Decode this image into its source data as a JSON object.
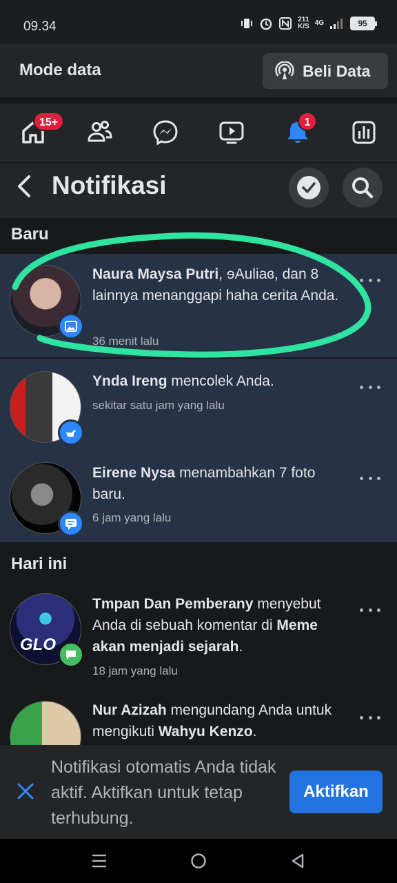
{
  "status_bar": {
    "time": "09.34",
    "net_speed_top": "211",
    "net_speed_unit": "K/S",
    "network": "4G",
    "battery": "95"
  },
  "data_bar": {
    "title": "Mode data",
    "buy_button": "Beli Data"
  },
  "nav": {
    "home_badge": "15+",
    "notifications_badge": "1",
    "icons": [
      "home-icon",
      "friends-icon",
      "messenger-icon",
      "watch-icon",
      "bell-icon",
      "dashboard-icon"
    ],
    "accent_color": "#2d88ff"
  },
  "header": {
    "title": "Notifikasi"
  },
  "sections": {
    "new": "Baru",
    "today": "Hari ini"
  },
  "notifications": [
    {
      "actor": "Naura Maysa Putri",
      "rest": ", ɘAuliaɞ, dan 8 lainnya menanggapi haha cerita Anda.",
      "time": "36 menit lalu",
      "badge_icon": "photo-icon"
    },
    {
      "actor": "Ynda Ireng",
      "rest": " mencolek Anda.",
      "time": "sekitar satu jam yang lalu",
      "badge_icon": "poke-icon"
    },
    {
      "actor": "Eirene Nysa",
      "rest": " menambahkan 7 foto baru.",
      "time": "6 jam yang lalu",
      "badge_icon": "photos-added-icon"
    },
    {
      "actor": "Tmpan Dan Pemberany",
      "rest": " menyebut Anda di sebuah komentar di ",
      "target": "Meme akan menjadi sejarah",
      "end": ".",
      "time": "18 jam yang lalu",
      "badge_icon": "comment-icon"
    },
    {
      "actor": "Nur Azizah",
      "rest": " mengundang Anda untuk mengikuti ",
      "target": "Wahyu Kenzo",
      "end": ".",
      "badge_icon": "invite-icon"
    }
  ],
  "prompt": {
    "text": "Notifikasi otomatis Anda tidak aktif. Aktifkan untuk tetap terhubung.",
    "button": "Aktifkan"
  },
  "avatar_label": "GLO"
}
